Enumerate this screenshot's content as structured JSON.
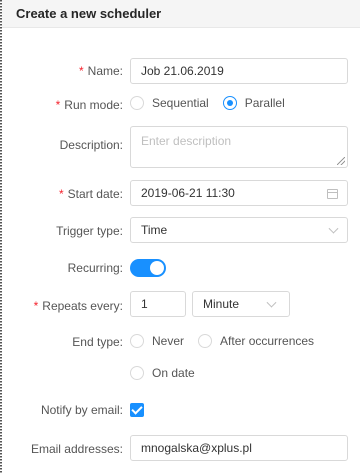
{
  "header": {
    "title": "Create a new scheduler"
  },
  "form": {
    "name": {
      "label": "Name:",
      "value": "Job 21.06.2019"
    },
    "run_mode": {
      "label": "Run mode:",
      "options": [
        "Sequential",
        "Parallel"
      ],
      "selected": "Parallel"
    },
    "description": {
      "label": "Description:",
      "placeholder": "Enter description"
    },
    "start_date": {
      "label": "Start date:",
      "value": "2019-06-21 11:30"
    },
    "trigger_type": {
      "label": "Trigger type:",
      "value": "Time"
    },
    "recurring": {
      "label": "Recurring:",
      "on": true
    },
    "repeats_every": {
      "label": "Repeats every:",
      "value": "1",
      "unit": "Minute"
    },
    "end_type": {
      "label": "End type:",
      "options": [
        "Never",
        "After occurrences",
        "On date"
      ]
    },
    "notify": {
      "label": "Notify by email:",
      "checked": true
    },
    "email": {
      "label": "Email addresses:",
      "value": "mnogalska@xplus.pl"
    }
  },
  "colors": {
    "accent": "#1890ff",
    "required": "#f5222d"
  }
}
